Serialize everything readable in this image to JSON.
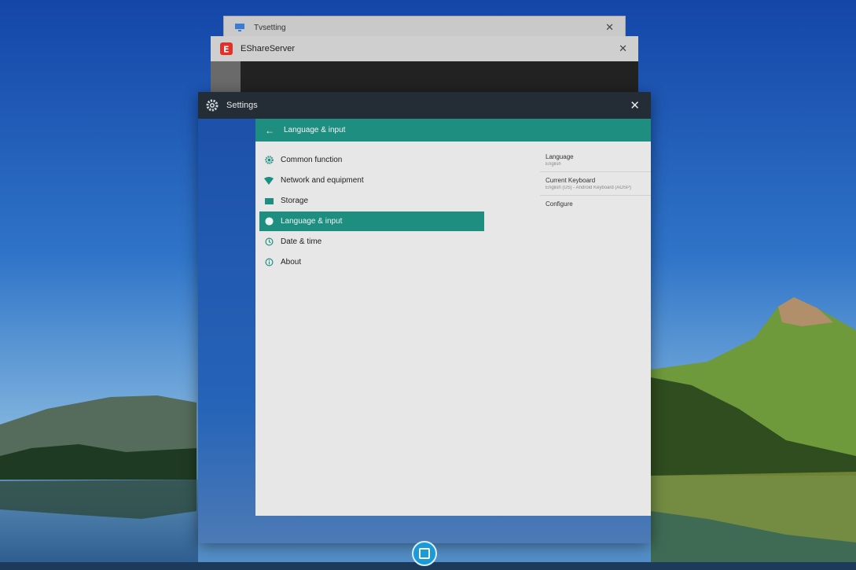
{
  "windows": {
    "back": {
      "title": "Tvsetting",
      "icon": "monitor-icon"
    },
    "middle": {
      "title": "EShareServer",
      "icon": "eshare-app-icon"
    },
    "settings": {
      "title": "Settings",
      "icon": "gear-icon"
    }
  },
  "panel": {
    "header_title": "Language & input"
  },
  "menu": {
    "items": [
      {
        "label": "Common function",
        "icon": "gear-icon"
      },
      {
        "label": "Network and equipment",
        "icon": "wifi-icon"
      },
      {
        "label": "Storage",
        "icon": "storage-icon"
      },
      {
        "label": "Language & input",
        "icon": "globe-icon",
        "active": true
      },
      {
        "label": "Date & time",
        "icon": "clock-icon"
      },
      {
        "label": "About",
        "icon": "info-icon"
      }
    ]
  },
  "detail": {
    "items": [
      {
        "title": "Language",
        "subtitle": "English"
      },
      {
        "title": "Current Keyboard",
        "subtitle": "English (US) - Android Keyboard (AOSP)"
      },
      {
        "title": "Configure",
        "subtitle": ""
      }
    ]
  },
  "colors": {
    "accent": "#1e8e80",
    "titlebar": "#242d36",
    "dock": "#1a9bd8"
  }
}
